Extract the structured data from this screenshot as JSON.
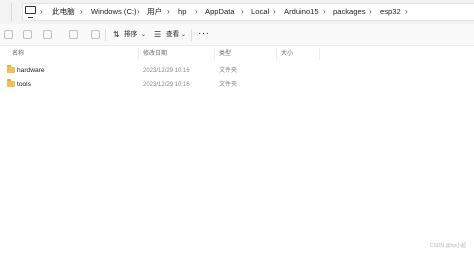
{
  "address_bar": {
    "crumbs": [
      "此电脑",
      "Windows (C:)",
      "用户",
      "hp",
      "AppData",
      "Local",
      "Arduino15",
      "packages",
      "esp32"
    ]
  },
  "toolbar": {
    "sort_label": "排序",
    "view_label": "查看",
    "more_label": "···"
  },
  "columns": {
    "name": "名称",
    "date": "修改日期",
    "type": "类型",
    "size": "大小"
  },
  "files": [
    {
      "name": "hardware",
      "date": "2023/12/29 10:16",
      "type": "文件夹",
      "size": ""
    },
    {
      "name": "tools",
      "date": "2023/12/29 10:16",
      "type": "文件夹",
      "size": ""
    }
  ],
  "watermark": "CSDN @hp小超",
  "colors": {
    "folder": "#f0c05a",
    "toolbar_bg": "#f9f9f9",
    "address_bg": "#f3f3f3"
  }
}
